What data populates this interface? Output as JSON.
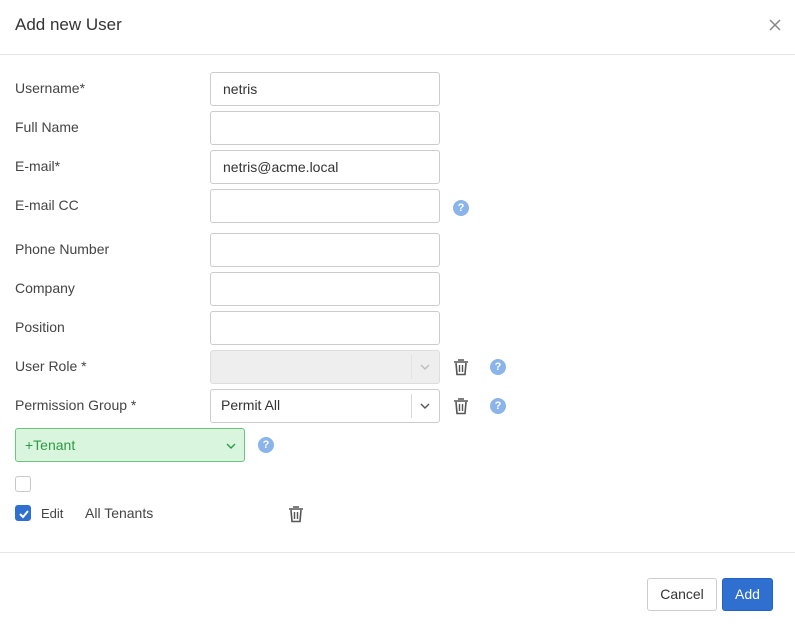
{
  "dialog": {
    "title": "Add new User"
  },
  "form": {
    "username": {
      "label": "Username*",
      "value": "netris"
    },
    "full_name": {
      "label": "Full Name",
      "value": ""
    },
    "email": {
      "label": "E-mail*",
      "value": "netris@acme.local"
    },
    "email_cc": {
      "label": "E-mail CC",
      "value": ""
    },
    "phone": {
      "label": "Phone Number",
      "value": ""
    },
    "company": {
      "label": "Company",
      "value": ""
    },
    "position": {
      "label": "Position",
      "value": ""
    },
    "user_role": {
      "label": "User Role *",
      "value": ""
    },
    "permission_group": {
      "label": "Permission Group *",
      "value": "Permit All"
    }
  },
  "tenant": {
    "dropdown_label": "+Tenant",
    "row": {
      "edit_label": "Edit",
      "name": "All Tenants",
      "edit_checked": true
    },
    "select_all_checked": false
  },
  "help_glyph": "?",
  "footer": {
    "cancel_label": "Cancel",
    "add_label": "Add"
  },
  "colors": {
    "primary": "#2f6fd0",
    "tenant_bg": "#d9f5de",
    "tenant_border": "#6cc47e",
    "tenant_text": "#2e9a45",
    "help_icon": "#8ab4ea"
  }
}
